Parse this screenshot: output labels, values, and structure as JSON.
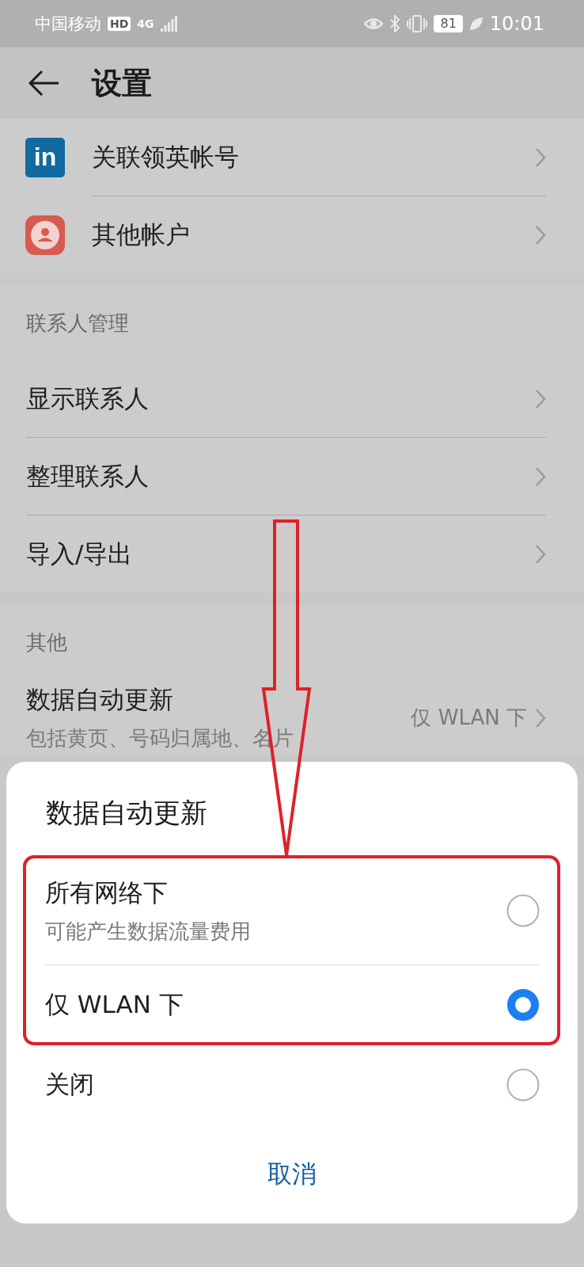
{
  "status_bar": {
    "carrier": "中国移动",
    "hd_badge": "HD",
    "network": "4G",
    "battery": "81",
    "time": "10:01"
  },
  "header": {
    "title": "设置"
  },
  "sections": [
    {
      "items": [
        {
          "icon": {
            "kind": "logo",
            "text": "in"
          },
          "label": "关联领英帐号"
        },
        {
          "icon": {
            "kind": "avatar"
          },
          "label": "其他帐户"
        }
      ]
    },
    {
      "title": "联系人管理",
      "items": [
        {
          "label": "显示联系人"
        },
        {
          "label": "整理联系人"
        },
        {
          "label": "导入/导出"
        }
      ]
    },
    {
      "title": "其他",
      "items": [
        {
          "label": "数据自动更新",
          "description": "包括黄页、号码归属地、名片",
          "value": "仅 WLAN 下"
        }
      ]
    }
  ],
  "dialog": {
    "title": "数据自动更新",
    "options": [
      {
        "label": "所有网络下",
        "description": "可能产生数据流量费用",
        "selected": false
      },
      {
        "label": "仅 WLAN 下",
        "selected": true
      },
      {
        "label": "关闭",
        "selected": false
      }
    ],
    "cancel": "取消"
  }
}
